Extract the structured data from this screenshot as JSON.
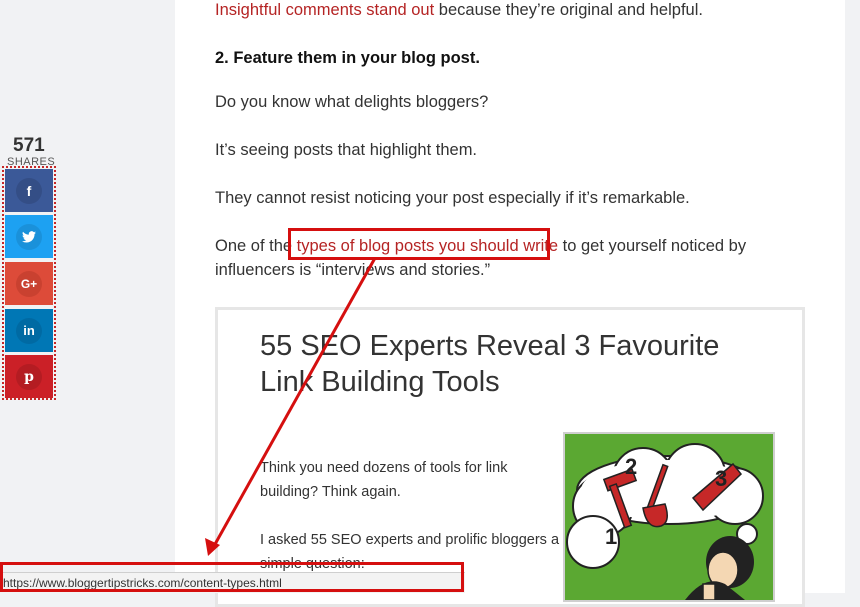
{
  "article": {
    "line1_link": "Insightful comments stand out",
    "line1_rest": " because they’re original and helpful.",
    "heading": "2. Feature them in your blog post.",
    "para1": "Do you know what delights bloggers?",
    "para2": "It’s seeing posts that highlight them.",
    "para3": "They cannot resist noticing your post especially if it’s remarkable.",
    "para4_before": "One of the",
    "para4_link": "types of blog posts you should write",
    "para4_after": " to get yourself noticed by",
    "para4_line2": "influencers is “interviews and stories.”"
  },
  "share": {
    "count": "571",
    "label": "SHARES",
    "buttons": [
      {
        "glyph": "f",
        "icon": "facebook-icon",
        "color": "#3b5998"
      },
      {
        "glyph": "t",
        "icon": "twitter-icon",
        "color": "#1da1f2"
      },
      {
        "glyph": "G+",
        "icon": "google-plus-icon",
        "color": "#dd4b39"
      },
      {
        "glyph": "in",
        "icon": "linkedin-icon",
        "color": "#0077b5"
      },
      {
        "glyph": "P",
        "icon": "pinterest-icon",
        "color": "#cb2027"
      }
    ]
  },
  "card": {
    "title": "55 SEO Experts Reveal 3 Favourite Link Building Tools",
    "text_line1": "Think you need dozens of tools for link",
    "text_line2": "building? Think again.",
    "text_line3": "I asked 55 SEO experts and prolific bloggers a",
    "text_line4": "simple question:",
    "image_numbers": [
      "1",
      "2",
      "3"
    ]
  },
  "status_bar": {
    "url": "https://www.bloggertipstricks.com/content-types.html"
  },
  "colors": {
    "link": "#b52424",
    "annotation": "#d50f0f"
  }
}
